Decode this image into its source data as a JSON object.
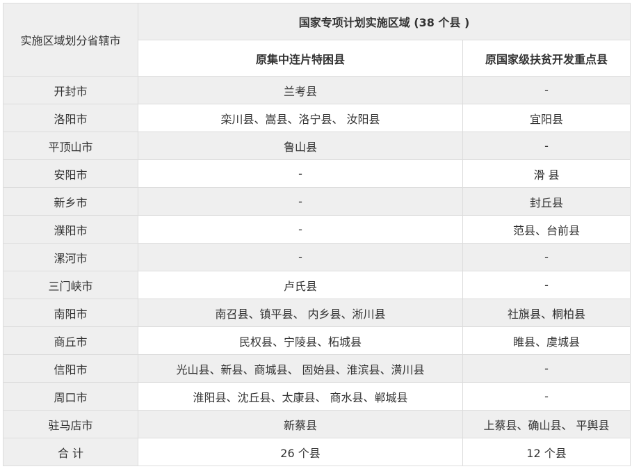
{
  "table": {
    "corner_header": "实施区域划分省辖市",
    "group_header": "国家专项计划实施区域 (38 个县 )",
    "sub_headers": [
      "原集中连片特困县",
      "原国家级扶贫开发重点县"
    ],
    "rows": [
      {
        "city": "开封市",
        "contiguous": "兰考县",
        "key": "-"
      },
      {
        "city": "洛阳市",
        "contiguous": "栾川县、嵩县、洛宁县、 汝阳县",
        "key": "宜阳县"
      },
      {
        "city": "平顶山市",
        "contiguous": "鲁山县",
        "key": "-"
      },
      {
        "city": "安阳市",
        "contiguous": "-",
        "key": "滑 县"
      },
      {
        "city": "新乡市",
        "contiguous": "-",
        "key": "封丘县"
      },
      {
        "city": "濮阳市",
        "contiguous": "-",
        "key": "范县、台前县"
      },
      {
        "city": "漯河市",
        "contiguous": "-",
        "key": "-"
      },
      {
        "city": "三门峡市",
        "contiguous": "卢氏县",
        "key": "-"
      },
      {
        "city": "南阳市",
        "contiguous": "南召县、镇平县、 内乡县、淅川县",
        "key": "社旗县、桐柏县"
      },
      {
        "city": "商丘市",
        "contiguous": "民权县、宁陵县、柘城县",
        "key": "睢县、虞城县"
      },
      {
        "city": "信阳市",
        "contiguous": "光山县、新县、商城县、 固始县、淮滨县、潢川县",
        "key": "-"
      },
      {
        "city": "周口市",
        "contiguous": "淮阳县、沈丘县、太康县、 商水县、郸城县",
        "key": "-"
      },
      {
        "city": "驻马店市",
        "contiguous": "新蔡县",
        "key": "上蔡县、确山县、 平舆县"
      },
      {
        "city": "合 计",
        "contiguous": "26 个县",
        "key": "12 个县"
      }
    ]
  }
}
